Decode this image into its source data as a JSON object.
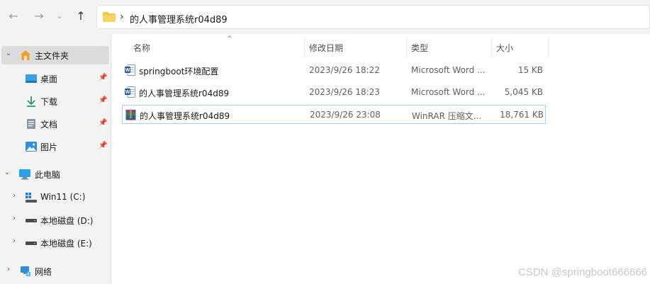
{
  "address_bar": {
    "separator": "›",
    "crumb": "的人事管理系统r04d89"
  },
  "sidebar": {
    "items": [
      {
        "label": "主文件夹",
        "icon": "home-icon"
      },
      {
        "label": "桌面",
        "icon": "desktop-icon",
        "pinned": true
      },
      {
        "label": "下载",
        "icon": "download-icon",
        "pinned": true
      },
      {
        "label": "文档",
        "icon": "document-icon",
        "pinned": true
      },
      {
        "label": "图片",
        "icon": "picture-icon",
        "pinned": true
      },
      {
        "label": "此电脑",
        "icon": "computer-icon"
      },
      {
        "label": "Win11 (C:)",
        "icon": "windows-drive-icon"
      },
      {
        "label": "本地磁盘 (D:)",
        "icon": "drive-icon"
      },
      {
        "label": "本地磁盘 (E:)",
        "icon": "drive-icon"
      },
      {
        "label": "网络",
        "icon": "network-icon"
      }
    ]
  },
  "columns": {
    "name": "名称",
    "date": "修改日期",
    "type": "类型",
    "size": "大小"
  },
  "files": [
    {
      "name": "springboot环境配置",
      "date": "2023/9/26 18:22",
      "type": "Microsoft Word ...",
      "size": "15 KB",
      "icon": "word-document-icon"
    },
    {
      "name": "的人事管理系统r04d89",
      "date": "2023/9/26 18:23",
      "type": "Microsoft Word ...",
      "size": "5,045 KB",
      "icon": "word-document-icon"
    },
    {
      "name": "的人事管理系统r04d89",
      "date": "2023/9/26 23:08",
      "type": "WinRAR 压缩文...",
      "size": "18,761 KB",
      "icon": "winrar-archive-icon"
    }
  ],
  "watermark": "CSDN @springboot666666",
  "colors": {
    "selected_border": "#a8cfee",
    "folder_yellow": "#f4c542",
    "word_blue": "#2b579a"
  }
}
